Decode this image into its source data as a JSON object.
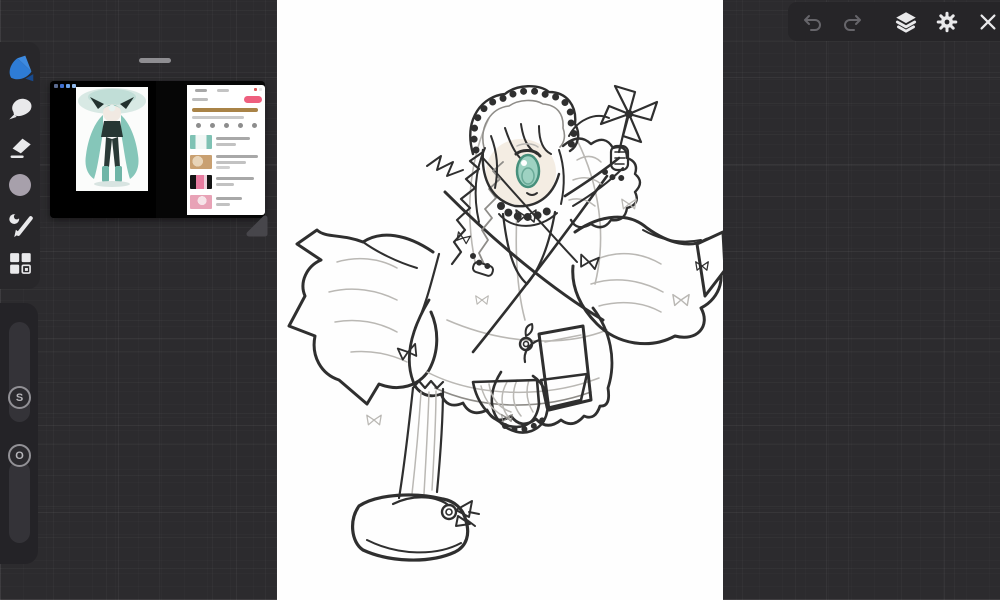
{
  "theme": {
    "accent-blue": "#2e7cd6",
    "eye-teal": "#9ed2c2",
    "eye-teal-dark": "#47907c",
    "pink-button": "#ee5f7e",
    "miku-teal": "#85c6b9",
    "canvas": "#fefefe",
    "bg": "#2c2b2e"
  },
  "top_toolbar": {
    "items": [
      {
        "name": "undo",
        "icon": "undo-arrow-icon",
        "enabled": false
      },
      {
        "name": "redo",
        "icon": "redo-arrow-icon",
        "enabled": false
      },
      {
        "name": "layers",
        "icon": "layers-icon",
        "enabled": true
      },
      {
        "name": "settings",
        "icon": "gear-icon",
        "enabled": true
      },
      {
        "name": "close",
        "icon": "close-x-icon",
        "enabled": true
      }
    ]
  },
  "left_toolbar": {
    "tools": [
      {
        "name": "app-logo",
        "icon": "infinite-painter-logo",
        "color": "#2e7cd6"
      },
      {
        "name": "smudge",
        "icon": "smudge-blob-icon"
      },
      {
        "name": "eraser",
        "icon": "eraser-icon"
      },
      {
        "name": "color",
        "icon": "color-swatch-circle",
        "color": "#a7a0ab"
      },
      {
        "name": "tools",
        "icon": "brush-and-circle-icon"
      },
      {
        "name": "workspace",
        "icon": "grid-squares-icon"
      }
    ]
  },
  "sliders": {
    "size": {
      "label": "S"
    },
    "opacity": {
      "label": "O"
    }
  },
  "reference_panel": {
    "left_image": {
      "subject": "teal twin-tail character artwork on white card, black background"
    },
    "right_image": {
      "subject": "mobile webpage screenshot with pink button and 4 list thumbnails"
    }
  },
  "canvas": {
    "artwork": "pencil line sketch of chibi lolita girl with bonnet, teal eye, frilled sleeves, pinwheel, platform shoe"
  }
}
